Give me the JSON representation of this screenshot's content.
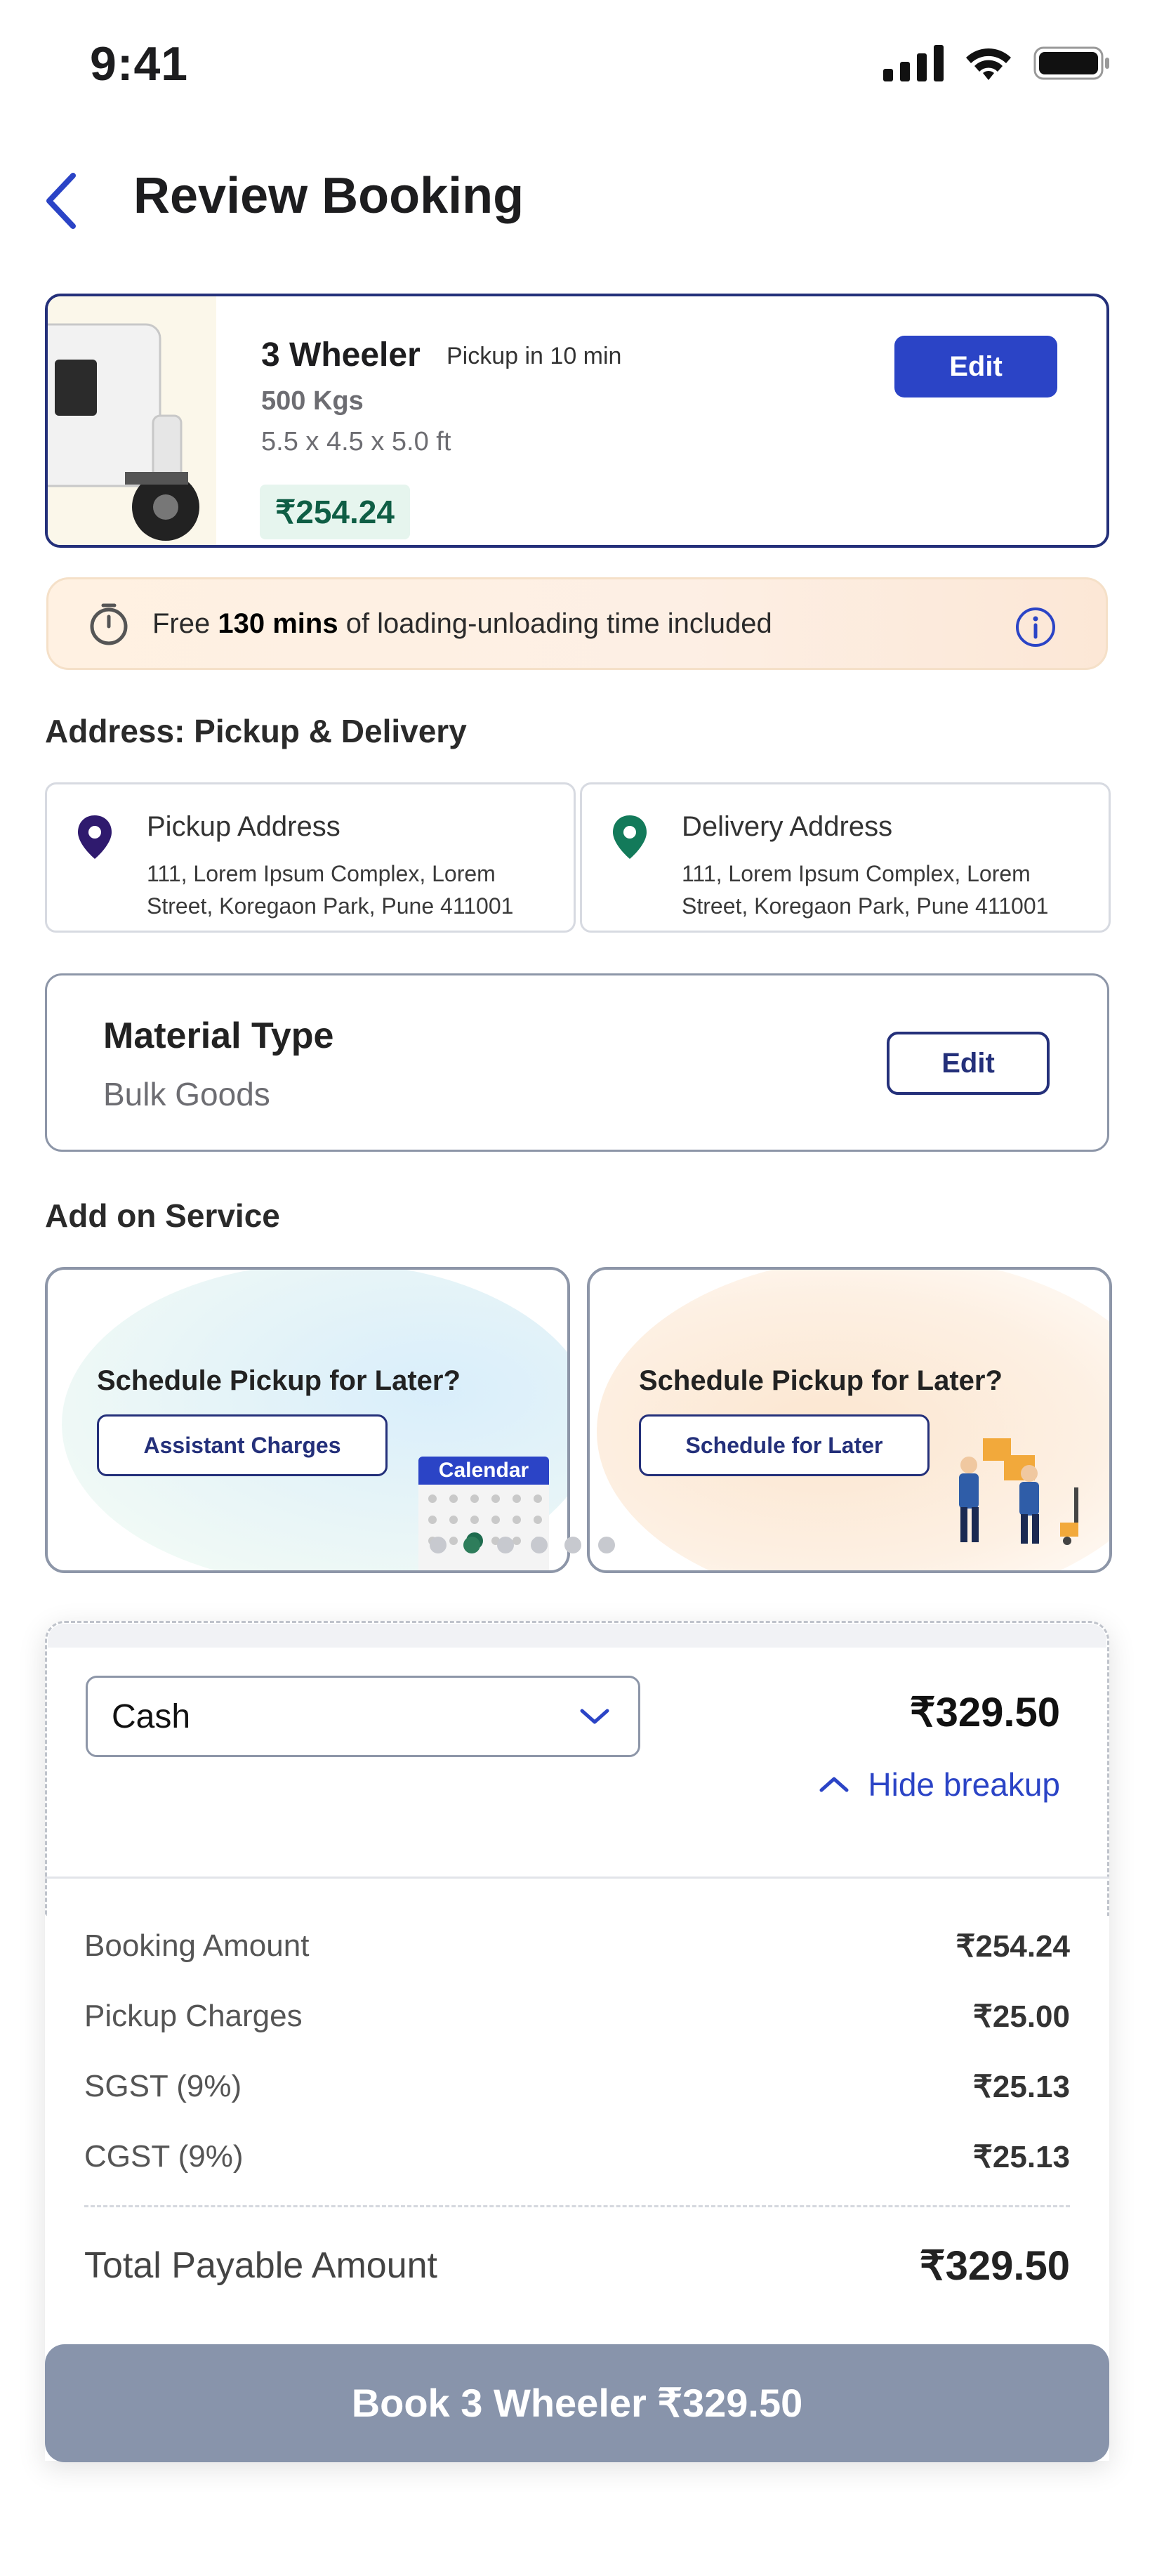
{
  "status_bar": {
    "time": "9:41"
  },
  "header": {
    "title": "Review Booking"
  },
  "vehicle": {
    "name": "3 Wheeler",
    "pickup_eta": "Pickup in 10 min",
    "capacity": "500 Kgs",
    "dimensions": "5.5 x 4.5 x 5.0 ft",
    "price": "₹254.24",
    "edit_label": "Edit"
  },
  "info_bar": {
    "prefix": "Free ",
    "highlight": "130 mins",
    "suffix": " of loading-unloading time included"
  },
  "address": {
    "section_title": "Address: Pickup & Delivery",
    "pickup": {
      "label": "Pickup Address",
      "text": "111, Lorem Ipsum Complex, Lorem Street, Koregaon Park, Pune 411001"
    },
    "delivery": {
      "label": "Delivery Address",
      "text": "111, Lorem Ipsum Complex, Lorem Street, Koregaon Park, Pune 411001"
    }
  },
  "material": {
    "title": "Material Type",
    "value": "Bulk Goods",
    "edit_label": "Edit"
  },
  "addon": {
    "section_title": "Add on Service",
    "cards": [
      {
        "title": "Schedule Pickup for Later?",
        "button": "Assistant Charges",
        "badge": "Calendar"
      },
      {
        "title": "Schedule Pickup for Later?",
        "button": "Schedule for Later"
      }
    ]
  },
  "payment": {
    "method": "Cash",
    "total": "₹329.50",
    "hide_breakup": "Hide breakup",
    "rows": [
      {
        "label": "Booking Amount",
        "value": "₹254.24"
      },
      {
        "label": "Pickup Charges",
        "value": "₹25.00"
      },
      {
        "label": "SGST (9%)",
        "value": "₹25.13"
      },
      {
        "label": "CGST (9%)",
        "value": "₹25.13"
      }
    ],
    "total_label": "Total Payable Amount",
    "total_value": "₹329.50"
  },
  "cta": {
    "label": "Book 3 Wheeler ₹329.50"
  },
  "colors": {
    "primary": "#2B44C6",
    "navy": "#24307A",
    "price_green": "#0F5E45",
    "cta_disabled": "#8894AB"
  }
}
